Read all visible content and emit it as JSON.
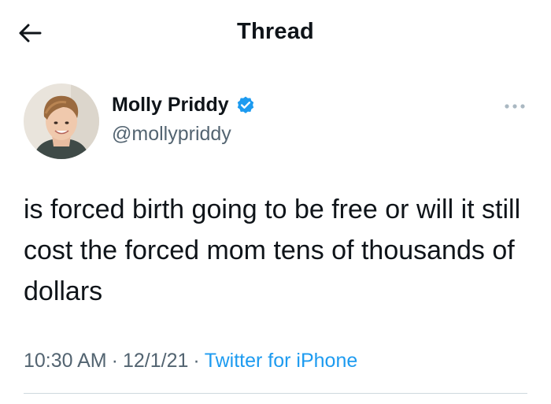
{
  "header": {
    "back_icon": "arrow-left-icon",
    "title": "Thread"
  },
  "tweet": {
    "author": {
      "display_name": "Molly Priddy",
      "handle": "@mollypriddy",
      "verified": true,
      "verified_icon": "verified-badge-icon",
      "avatar_icon": "avatar-photo"
    },
    "more_icon": "more-horizontal-icon",
    "text": "is forced birth going to be free or will it still cost the forced mom tens of thousands of dollars",
    "time": "10:30 AM",
    "date": "12/1/21",
    "separator": "·",
    "source": "Twitter for iPhone"
  },
  "colors": {
    "text_primary": "#0f1419",
    "text_secondary": "#536471",
    "accent": "#1d9bf0",
    "divider": "#cfd9de"
  }
}
